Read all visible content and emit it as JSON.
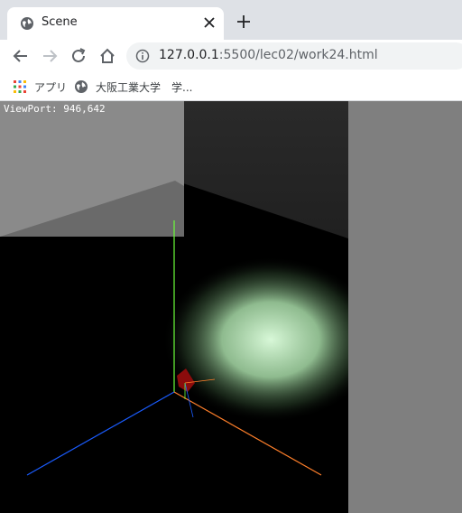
{
  "tab": {
    "title": "Scene",
    "favicon": "globe-icon",
    "close_icon": "close-icon"
  },
  "toolbar": {
    "url_host": "127.0.0.1",
    "url_rest": ":5500/lec02/work24.html"
  },
  "bookmarks": {
    "items": [
      {
        "label": "アプリ",
        "icon": "apps-grid-icon"
      },
      {
        "label": "大阪工業大学",
        "icon": "globe-icon"
      },
      {
        "label": "学...",
        "icon": ""
      }
    ]
  },
  "scene": {
    "viewport_label": "ViewPort: 946,642",
    "colors": {
      "background": "#000000",
      "page": "#7f7f7f",
      "axis_x": "#ff7f2a",
      "axis_y": "#6cff3a",
      "axis_z": "#1a5cff",
      "spotlight": "#c8f0c8"
    }
  }
}
